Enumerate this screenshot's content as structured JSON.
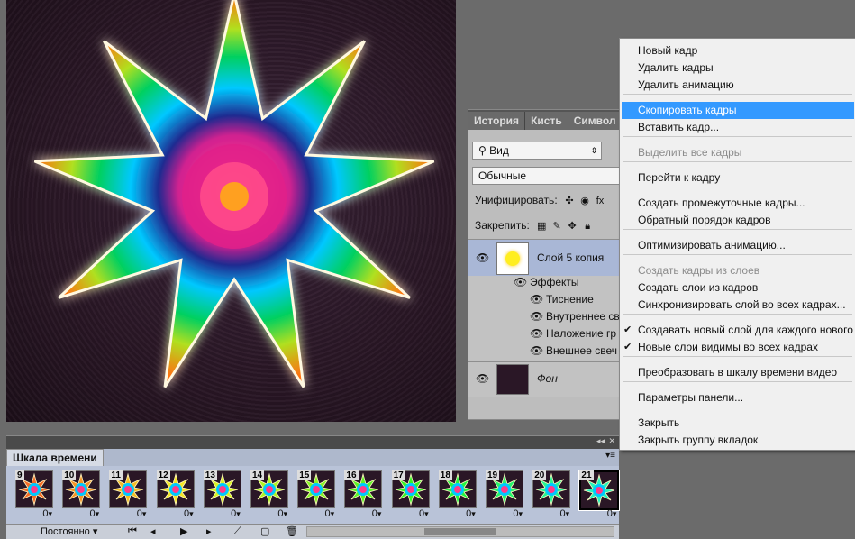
{
  "layers_panel": {
    "tabs": [
      "История",
      "Кисть",
      "Символ"
    ],
    "filter_kind": "Вид",
    "blend_mode": "Обычные",
    "unify_label": "Унифицировать:",
    "lock_label": "Закрепить:",
    "layers": [
      {
        "name": "Слой 5 копия",
        "selected": true
      },
      {
        "name": "Фон",
        "selected": false
      }
    ],
    "effects_label": "Эффекты",
    "effects": [
      "Тиснение",
      "Внутреннее св",
      "Наложение гр",
      "Внешнее свеч"
    ]
  },
  "context_menu": {
    "items": [
      {
        "label": "Новый кадр",
        "disabled": false,
        "highlighted": false,
        "checked": false
      },
      {
        "label": "Удалить кадры",
        "disabled": false,
        "highlighted": false,
        "checked": false
      },
      {
        "label": "Удалить анимацию",
        "disabled": false,
        "highlighted": false,
        "checked": false
      },
      {
        "label": "Скопировать кадры",
        "disabled": false,
        "highlighted": true,
        "checked": false
      },
      {
        "label": "Вставить кадр...",
        "disabled": false,
        "highlighted": false,
        "checked": false
      },
      {
        "label": "Выделить все кадры",
        "disabled": true,
        "highlighted": false,
        "checked": false
      },
      {
        "label": "Перейти к кадру",
        "disabled": false,
        "highlighted": false,
        "checked": false
      },
      {
        "label": "Создать промежуточные кадры...",
        "disabled": false,
        "highlighted": false,
        "checked": false
      },
      {
        "label": "Обратный порядок кадров",
        "disabled": false,
        "highlighted": false,
        "checked": false
      },
      {
        "label": "Оптимизировать анимацию...",
        "disabled": false,
        "highlighted": false,
        "checked": false
      },
      {
        "label": "Создать кадры из слоев",
        "disabled": true,
        "highlighted": false,
        "checked": false
      },
      {
        "label": "Создать слои из кадров",
        "disabled": false,
        "highlighted": false,
        "checked": false
      },
      {
        "label": "Синхронизировать слой во всех кадрах...",
        "disabled": false,
        "highlighted": false,
        "checked": false
      },
      {
        "label": "Создавать новый слой для каждого нового к",
        "disabled": false,
        "highlighted": false,
        "checked": true
      },
      {
        "label": "Новые слои видимы во всех кадрах",
        "disabled": false,
        "highlighted": false,
        "checked": true
      },
      {
        "label": "Преобразовать в шкалу времени видео",
        "disabled": false,
        "highlighted": false,
        "checked": false
      },
      {
        "label": "Параметры панели...",
        "disabled": false,
        "highlighted": false,
        "checked": false
      },
      {
        "label": "Закрыть",
        "disabled": false,
        "highlighted": false,
        "checked": false
      },
      {
        "label": "Закрыть группу вкладок",
        "disabled": false,
        "highlighted": false,
        "checked": false
      }
    ]
  },
  "timeline": {
    "tab": "Шкала времени",
    "frames": [
      {
        "num": "9",
        "delay": "0"
      },
      {
        "num": "10",
        "delay": "0"
      },
      {
        "num": "11",
        "delay": "0"
      },
      {
        "num": "12",
        "delay": "0"
      },
      {
        "num": "13",
        "delay": "0"
      },
      {
        "num": "14",
        "delay": "0"
      },
      {
        "num": "15",
        "delay": "0"
      },
      {
        "num": "16",
        "delay": "0"
      },
      {
        "num": "17",
        "delay": "0"
      },
      {
        "num": "18",
        "delay": "0"
      },
      {
        "num": "19",
        "delay": "0"
      },
      {
        "num": "20",
        "delay": "0"
      },
      {
        "num": "21",
        "delay": "0"
      }
    ],
    "loop": "Постоянно"
  },
  "colors": {
    "highlight": "#3399ff",
    "canvas_bg": "#2a1726"
  }
}
